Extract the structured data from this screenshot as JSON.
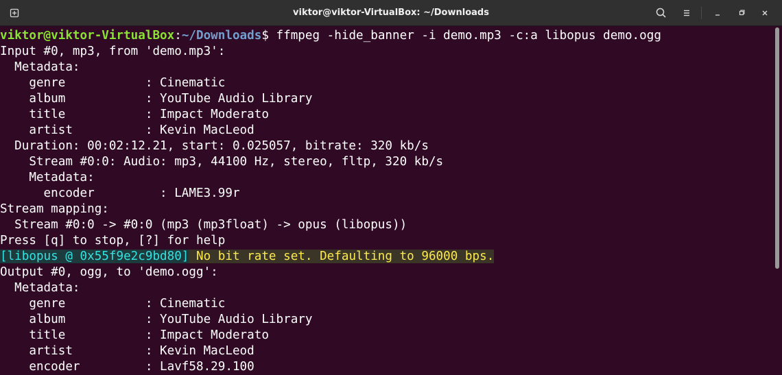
{
  "window": {
    "title": "viktor@viktor-VirtualBox: ~/Downloads",
    "icons": {
      "new_tab": "new-tab-icon",
      "search": "search-icon",
      "menu": "hamburger-menu-icon",
      "minimize": "minimize-icon",
      "maximize": "maximize-icon",
      "close": "close-icon"
    }
  },
  "colors": {
    "background": "#300a24",
    "prompt_user": "#8ae234",
    "prompt_path": "#729fcf",
    "warn_tag": "#34e2e2",
    "warn_message": "#fce94f"
  },
  "prompt": {
    "user_host": "viktor@viktor-VirtualBox",
    "separator": ":",
    "path": "~/Downloads",
    "symbol": "$",
    "command": " ffmpeg -hide_banner -i demo.mp3 -c:a libopus demo.ogg"
  },
  "output": {
    "l1": "Input #0, mp3, from 'demo.mp3':",
    "l2": "  Metadata:",
    "l3": "    genre           : Cinematic",
    "l4": "    album           : YouTube Audio Library",
    "l5": "    title           : Impact Moderato",
    "l6": "    artist          : Kevin MacLeod",
    "l7": "  Duration: 00:02:12.21, start: 0.025057, bitrate: 320 kb/s",
    "l8": "    Stream #0:0: Audio: mp3, 44100 Hz, stereo, fltp, 320 kb/s",
    "l9": "    Metadata:",
    "l10": "      encoder         : LAME3.99r",
    "l11": "Stream mapping:",
    "l12": "  Stream #0:0 -> #0:0 (mp3 (mp3float) -> opus (libopus))",
    "l13": "Press [q] to stop, [?] for help",
    "warn_tag": "[libopus @ 0x55f9e2c9bd80]",
    "warn_msg": " No bit rate set. Defaulting to 96000 bps.",
    "l15": "Output #0, ogg, to 'demo.ogg':",
    "l16": "  Metadata:",
    "l17": "    genre           : Cinematic",
    "l18": "    album           : YouTube Audio Library",
    "l19": "    title           : Impact Moderato",
    "l20": "    artist          : Kevin MacLeod",
    "l21": "    encoder         : Lavf58.29.100"
  }
}
